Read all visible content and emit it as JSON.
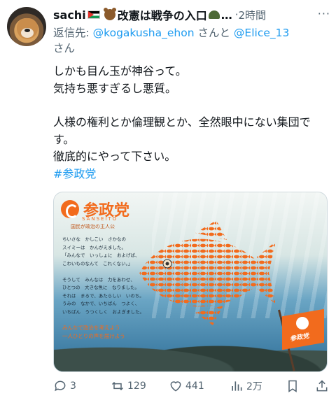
{
  "author": {
    "name": "sachi",
    "display_suffix": "改憲は戦争の入口",
    "ellipsis": "…",
    "time": "2時間",
    "more": "···"
  },
  "reply": {
    "prefix": "返信先: ",
    "handle1": "@kogakusha_ehon",
    "and": " さんと ",
    "handle2": "@Elice_13",
    "suffix": "さん"
  },
  "tweet": {
    "line1": "しかも目ん玉が神谷って。\n気持ち悪すぎるし悪質。",
    "line2": "人様の権利とか倫理観とか、全然眼中にない集団です。\n徹底的にやって下さい。",
    "hashtag": "#参政党"
  },
  "media": {
    "logo_text": "参政党",
    "logo_sub": "SANSEITO",
    "logo_sub2": "国民が政治の主人公",
    "story": "ちいさな　かしこい　さかなの\nスイミーは　かんがえました。\n「みんなで　いっしょに　およげば、\nこわいものなんて　これくない。」\n\nそうして　みんなは　力をあわせ、\nひとつの　大きな魚に　なりました。\nそれは　まるで、あたらしい　いのち。\nうみの　なかで、いちばん　つよく、\nいちばん　うつくしく　およぎました。",
    "slogan": "みんなで政治を考えよう\n一人ひとりの声を届けよう",
    "flag_text": "参政党"
  },
  "actions": {
    "replies": "3",
    "reposts": "129",
    "likes": "441",
    "views": "2万"
  },
  "colors": {
    "link": "#1d9bf0",
    "muted": "#536471",
    "brand_orange": "#f26b1d"
  }
}
